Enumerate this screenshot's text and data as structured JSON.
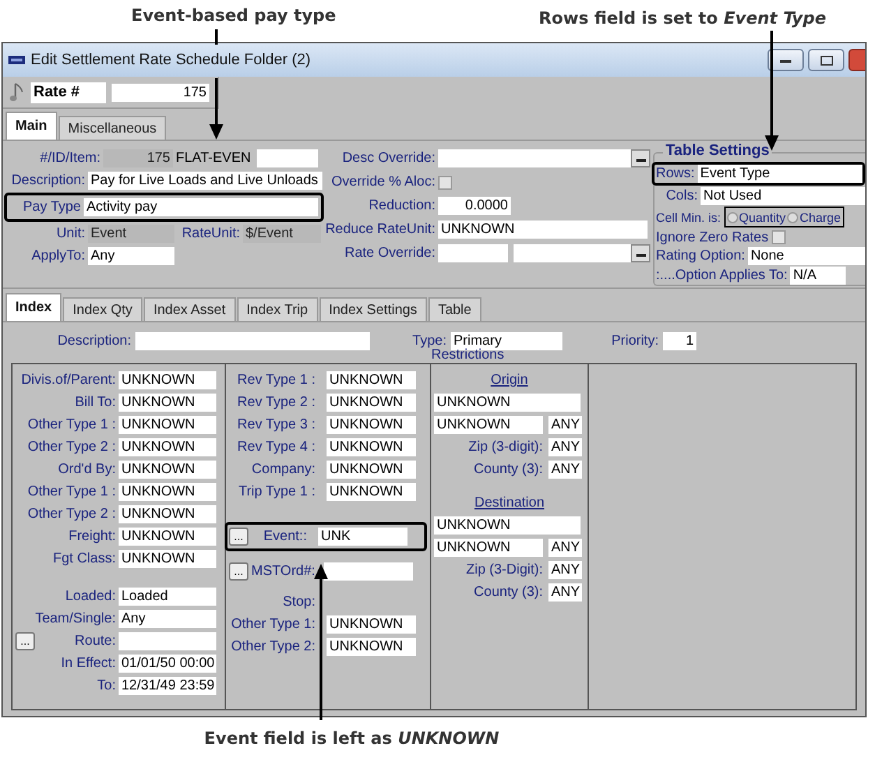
{
  "annotations": {
    "top_left": "Event-based pay type",
    "top_right": "Rows field is set to *Event Type*",
    "bottom": "Event field is left as *UNKNOWN*"
  },
  "window": {
    "title": "Edit Settlement Rate Schedule Folder (2)"
  },
  "rate": {
    "label": "Rate #",
    "value": "175"
  },
  "tabs": [
    {
      "label": "Main",
      "selected": true
    },
    {
      "label": "Miscellaneous",
      "selected": false
    }
  ],
  "main": {
    "id_item": {
      "label": "#/ID/Item:",
      "number": "175",
      "id": "FLAT-EVEN"
    },
    "description": {
      "label": "Description:",
      "value": "Pay for Live Loads and Live Unloads"
    },
    "pay_type": {
      "label": "Pay Type",
      "value": "Activity pay",
      "highlighted": true
    },
    "unit": {
      "label": "Unit:",
      "value": "Event"
    },
    "rate_unit": {
      "label": "RateUnit:",
      "value": "$/Event"
    },
    "apply_to": {
      "label": "ApplyTo:",
      "value": "Any"
    },
    "desc_override": {
      "label": "Desc Override:"
    },
    "override_aloc": {
      "label": "Override % Aloc:",
      "checked": false
    },
    "reduction": {
      "label": "Reduction:",
      "value": "0.0000"
    },
    "reduce_rate_unit": {
      "label": "Reduce RateUnit:",
      "value": "UNKNOWN"
    },
    "rate_override": {
      "label": "Rate Override:"
    }
  },
  "table_settings": {
    "title": "Table Settings",
    "rows": {
      "label": "Rows:",
      "value": "Event Type",
      "highlighted": true
    },
    "cols": {
      "label": "Cols:",
      "value": "Not Used"
    },
    "cell_min": {
      "label": "Cell Min. is:",
      "options": [
        {
          "label": "Quantity",
          "selected": false
        },
        {
          "label": "Charge",
          "selected": false
        }
      ]
    },
    "ignore_zero": {
      "label": "Ignore Zero Rates",
      "checked": false
    },
    "rating_option": {
      "label": "Rating Option:",
      "value": "None"
    },
    "option_applies": {
      "label": ":....Option Applies To:",
      "value": "N/A"
    }
  },
  "index_tabs": [
    {
      "label": "Index",
      "selected": true
    },
    {
      "label": "Index Qty",
      "selected": false
    },
    {
      "label": "Index Asset",
      "selected": false
    },
    {
      "label": "Index Trip",
      "selected": false
    },
    {
      "label": "Index Settings",
      "selected": false
    },
    {
      "label": "Table",
      "selected": false
    }
  ],
  "index": {
    "description": {
      "label": "Description:"
    },
    "type": {
      "label": "Type:",
      "value": "Primary"
    },
    "priority": {
      "label": "Priority:",
      "value": "1"
    },
    "restrictions_title": "Restrictions",
    "col1_top": [
      {
        "label": "Divis.of/Parent:",
        "value": "UNKNOWN"
      },
      {
        "label": "Bill To:",
        "value": "UNKNOWN"
      },
      {
        "label": "Other Type 1 :",
        "value": "UNKNOWN"
      },
      {
        "label": "Other Type 2 :",
        "value": "UNKNOWN"
      },
      {
        "label": "Ord'd By:",
        "value": "UNKNOWN"
      },
      {
        "label": "Other Type 1 :",
        "value": "UNKNOWN"
      },
      {
        "label": "Other Type 2 :",
        "value": "UNKNOWN"
      },
      {
        "label": "Freight:",
        "value": "UNKNOWN"
      },
      {
        "label": "Fgt Class:",
        "value": "UNKNOWN"
      }
    ],
    "col1_bottom": [
      {
        "kind": "field",
        "label": "Loaded:",
        "value": "Loaded"
      },
      {
        "kind": "field",
        "label": "Team/Single:",
        "value": "Any"
      },
      {
        "kind": "lookup",
        "button": "...",
        "label": "Route:"
      },
      {
        "kind": "field",
        "label": "In Effect:",
        "value": "01/01/50 00:00"
      },
      {
        "kind": "field",
        "label": "To:",
        "value": "12/31/49 23:59"
      }
    ],
    "col2_top": [
      {
        "label": "Rev Type 1 :",
        "value": "UNKNOWN"
      },
      {
        "label": "Rev Type 2 :",
        "value": "UNKNOWN"
      },
      {
        "label": "Rev Type 3 :",
        "value": "UNKNOWN"
      },
      {
        "label": "Rev Type 4 :",
        "value": "UNKNOWN"
      },
      {
        "label": "Company:",
        "value": "UNKNOWN"
      },
      {
        "label": "Trip Type 1 :",
        "value": "UNKNOWN"
      }
    ],
    "event": {
      "button": "...",
      "label": "Event::",
      "value": "UNK",
      "highlighted": true
    },
    "mstord": {
      "button": "...",
      "label": "MSTOrd#:"
    },
    "stop": {
      "title": "Stop:",
      "fields": [
        {
          "label": "Other Type 1:",
          "value": "UNKNOWN"
        },
        {
          "label": "Other Type 2:",
          "value": "UNKNOWN"
        }
      ]
    },
    "origin": {
      "title": "Origin",
      "line1": "UNKNOWN",
      "line2": "UNKNOWN",
      "line2_code": "ANY",
      "zip": {
        "label": "Zip (3-digit):",
        "value": "ANY"
      },
      "county": {
        "label": "County (3):",
        "value": "ANY"
      }
    },
    "destination": {
      "title": "Destination",
      "line1": "UNKNOWN",
      "line2": "UNKNOWN",
      "line2_code": "ANY",
      "zip": {
        "label": "Zip (3-Digit):",
        "value": "ANY"
      },
      "county": {
        "label": "County (3):",
        "value": "ANY"
      }
    }
  }
}
